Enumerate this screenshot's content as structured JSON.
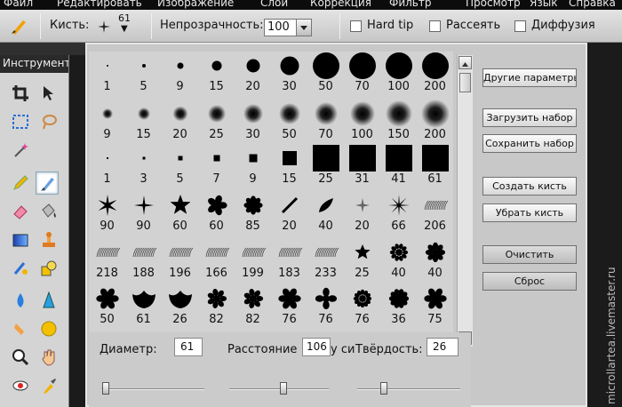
{
  "menu": [
    "Файл",
    "Редактировать",
    "Изображение",
    "Слой",
    "Коррекция",
    "Фильтр",
    "Просмотр",
    "Язык",
    "Справка"
  ],
  "toolbar": {
    "brush_label": "Кисть:",
    "brush_size": "61",
    "opacity_label": "Непрозрачность:",
    "opacity_value": "100",
    "hardtip_label": "Hard tip",
    "scatter_label": "Рассеять",
    "diffusion_label": "Диффузия"
  },
  "tools_panel": {
    "title": "Инструменты"
  },
  "brushes": {
    "rows": [
      [
        "1",
        "5",
        "9",
        "15",
        "20",
        "30",
        "50",
        "70",
        "100",
        "200"
      ],
      [
        "9",
        "15",
        "20",
        "25",
        "30",
        "50",
        "70",
        "100",
        "150",
        "200"
      ],
      [
        "1",
        "3",
        "5",
        "7",
        "9",
        "15",
        "25",
        "31",
        "41",
        "61"
      ],
      [
        "90",
        "90",
        "60",
        "60",
        "85",
        "20",
        "40",
        "20",
        "66",
        "206"
      ],
      [
        "218",
        "188",
        "196",
        "166",
        "199",
        "183",
        "233",
        "25",
        "40",
        "40"
      ],
      [
        "50",
        "61",
        "26",
        "82",
        "82",
        "76",
        "76",
        "76",
        "36",
        "75"
      ],
      [
        "",
        "",
        "",
        "",
        "",
        "",
        "",
        "",
        "",
        ""
      ]
    ]
  },
  "side_buttons": {
    "other_params": "Другие параметры",
    "load_set": "Загрузить набор",
    "save_set": "Сохранить набор",
    "create_brush": "Создать кисть",
    "remove_brush": "Убрать кисть",
    "clear": "Очистить",
    "reset": "Сброс"
  },
  "bottom": {
    "diameter_label": "Диаметр:",
    "diameter_value": "61",
    "spacing_label": "Расстояние",
    "spacing_value": "106",
    "overlap_text": "у си",
    "hardness_label": "Твёрдость:",
    "hardness_value": "26"
  },
  "watermark": "microllartea.livemaster.ru",
  "colors": {
    "accent": "#c6c6c6",
    "dark": "#1b1b1b"
  }
}
